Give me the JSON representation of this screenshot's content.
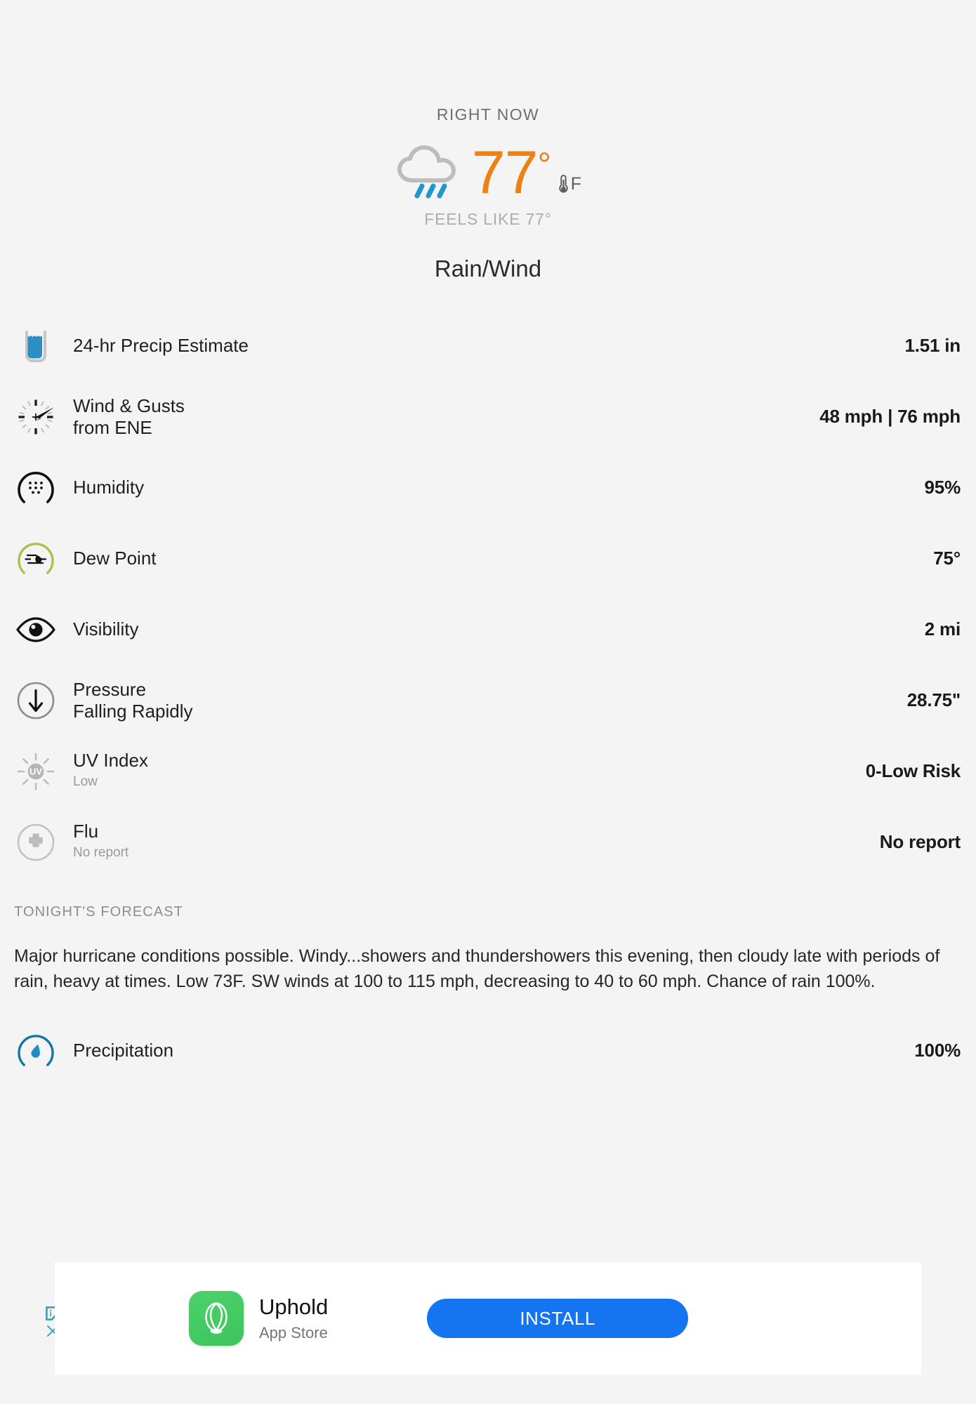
{
  "now": {
    "label": "RIGHT NOW",
    "icon": "cloud-rain-icon",
    "temperature": "77",
    "degree": "°",
    "unit": "F",
    "feels_like": "FEELS LIKE 77°",
    "condition": "Rain/Wind",
    "temp_color": "#ee8014"
  },
  "details": [
    {
      "icon": "rain-gauge-icon",
      "label": "24-hr Precip Estimate",
      "sub_dark": "",
      "sub_grey": "",
      "value": "1.51 in"
    },
    {
      "icon": "wind-compass-icon",
      "label": "Wind & Gusts",
      "sub_dark": "from ENE",
      "sub_grey": "",
      "value": "48 mph | 76 mph"
    },
    {
      "icon": "humidity-gauge-icon",
      "label": "Humidity",
      "sub_dark": "",
      "sub_grey": "",
      "value": "95%"
    },
    {
      "icon": "dew-point-gauge-icon",
      "label": "Dew Point",
      "sub_dark": "",
      "sub_grey": "",
      "value": "75°"
    },
    {
      "icon": "eye-icon",
      "label": "Visibility",
      "sub_dark": "",
      "sub_grey": "",
      "value": "2 mi"
    },
    {
      "icon": "pressure-down-arrow-icon",
      "label": "Pressure",
      "sub_dark": "Falling Rapidly",
      "sub_grey": "",
      "value": "28.75\""
    },
    {
      "icon": "uv-sun-icon",
      "label": "UV Index",
      "sub_dark": "",
      "sub_grey": "Low",
      "value": "0-Low Risk"
    },
    {
      "icon": "flu-plus-icon",
      "label": "Flu",
      "sub_dark": "",
      "sub_grey": "No report",
      "value": "No report"
    }
  ],
  "forecast": {
    "heading": "TONIGHT'S FORECAST",
    "body": "Major hurricane conditions possible. Windy...showers and thundershowers this evening, then cloudy late with periods of rain, heavy at times. Low 73F. SW winds at 100 to 115 mph, decreasing to 40 to 60 mph. Chance of rain 100%.",
    "precipitation": {
      "icon": "precipitation-gauge-icon",
      "label": "Precipitation",
      "value": "100%"
    }
  },
  "ad": {
    "title": "Uphold",
    "subtitle": "App Store",
    "install_label": "INSTALL",
    "logo_icon": "uphold-logo-icon",
    "adchoices_icon": "adchoices-icon",
    "close_icon": "close-icon",
    "button_color": "#1574f0",
    "logo_color": "#44cb64"
  }
}
